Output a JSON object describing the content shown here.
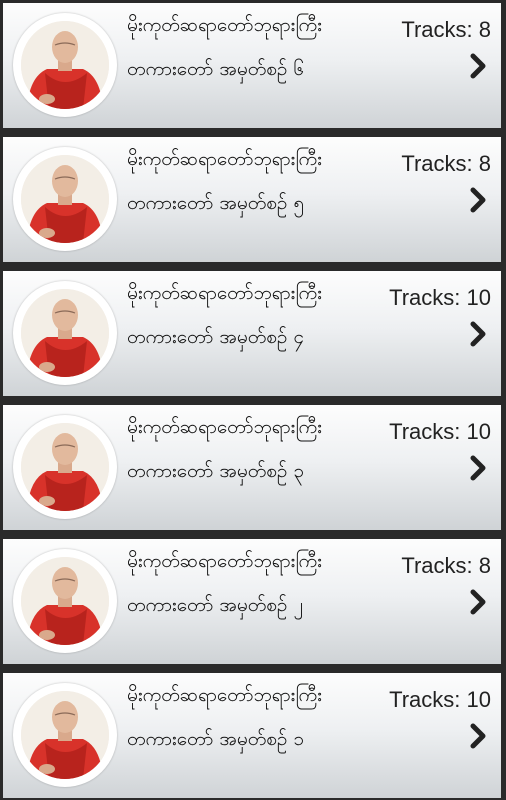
{
  "albums": [
    {
      "title": "မိုးကုတ်ဆရာတော်ဘုရားကြီး",
      "subtitle": "တကားတော် အမှတ်စဥ် ၆",
      "tracks": "Tracks: 8"
    },
    {
      "title": "မိုးကုတ်ဆရာတော်ဘုရားကြီး",
      "subtitle": "တကားတော် အမှတ်စဥ် ၅",
      "tracks": "Tracks: 8"
    },
    {
      "title": "မိုးကုတ်ဆရာတော်ဘုရားကြီး",
      "subtitle": "တကားတော် အမှတ်စဥ် ၄",
      "tracks": "Tracks: 10"
    },
    {
      "title": "မိုးကုတ်ဆရာတော်ဘုရားကြီး",
      "subtitle": "တကားတော် အမှတ်စဥ် ၃",
      "tracks": "Tracks: 10"
    },
    {
      "title": "မိုးကုတ်ဆရာတော်ဘုရားကြီး",
      "subtitle": "တကားတော် အမှတ်စဥ် ၂",
      "tracks": "Tracks: 8"
    },
    {
      "title": "မိုးကုတ်ဆရာတော်ဘုရားကြီး",
      "subtitle": "တကားတော် အမှတ်စဥ် ၁",
      "tracks": "Tracks: 10"
    }
  ],
  "icons": {
    "thumbnail": "monk-portrait",
    "chevron": "chevron-right-icon"
  },
  "colors": {
    "robe": "#d8322a",
    "card_top": "#fdfdfd",
    "card_bottom": "#cfd3d6",
    "background": "#2a2a2a"
  }
}
